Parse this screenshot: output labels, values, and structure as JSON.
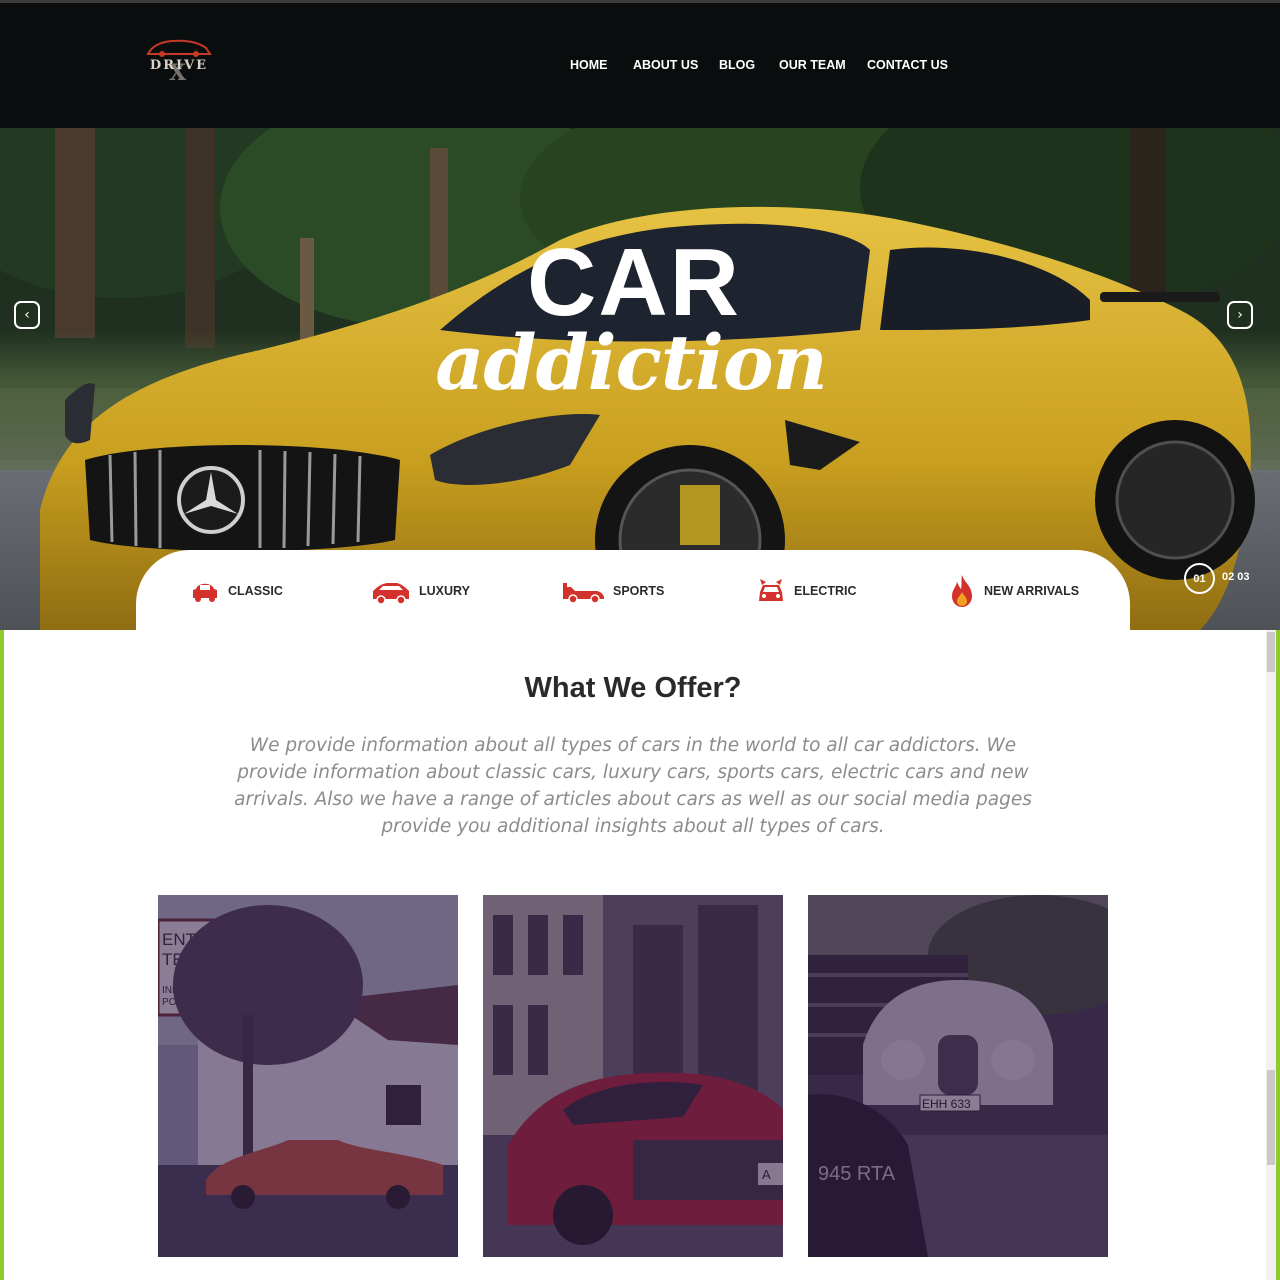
{
  "brand": {
    "logo_text": "DRIVE",
    "logo_mark": "X"
  },
  "nav": {
    "items": [
      {
        "label": "HOME"
      },
      {
        "label": "ABOUT US"
      },
      {
        "label": "BLOG"
      },
      {
        "label": "OUR TEAM"
      },
      {
        "label": "CONTACT US"
      }
    ]
  },
  "hero": {
    "title_line1": "CAR",
    "title_line2": "addiction",
    "prev_icon": "chevron-left-icon",
    "next_icon": "chevron-right-icon",
    "slides": {
      "current": "01",
      "others": "02 03"
    }
  },
  "categories": [
    {
      "label": "CLASSIC",
      "icon": "classic-car-icon"
    },
    {
      "label": "LUXURY",
      "icon": "luxury-car-icon"
    },
    {
      "label": "SPORTS",
      "icon": "sports-car-icon"
    },
    {
      "label": "ELECTRIC",
      "icon": "electric-car-icon"
    },
    {
      "label": "NEW ARRIVALS",
      "icon": "fire-icon"
    }
  ],
  "offer": {
    "title": "What We Offer?",
    "description": "We provide information about all types of cars in the world to all car addictors. We provide information about classic cars, luxury cars, sports cars, electric cars and new arrivals. Also we have a range of articles about cars as well as our social media pages provide you additional insights about all types of cars."
  },
  "gallery": {
    "card1_sign": "ENTER TEL INDOOR POOL",
    "card2_plate": "A",
    "card3_plates": [
      "EHH 633",
      "945 RTA"
    ]
  },
  "colors": {
    "accent_red": "#d3312b",
    "frame_green": "#8fca2e",
    "nav_bg": "#0b0d10",
    "car_yellow": "#d9b22e",
    "card_tint": "#341e48"
  }
}
